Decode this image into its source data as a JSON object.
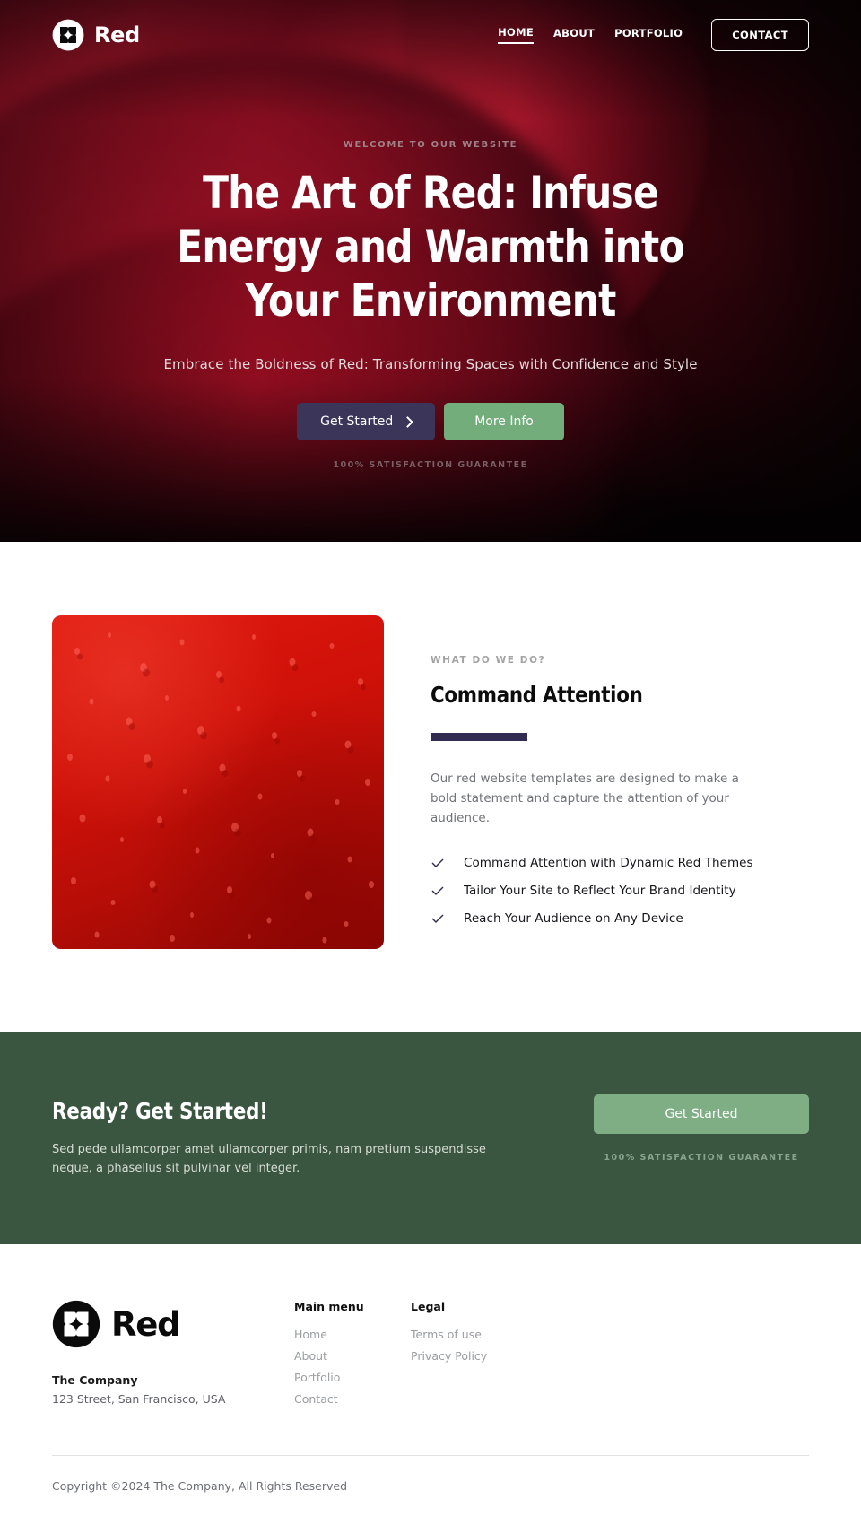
{
  "brand": {
    "name": "Red",
    "logo_icon": "red-petal-logo-icon"
  },
  "nav": {
    "links": [
      {
        "label": "HOME",
        "active": true
      },
      {
        "label": "ABOUT",
        "active": false
      },
      {
        "label": "PORTFOLIO",
        "active": false
      }
    ],
    "cta_label": "CONTACT"
  },
  "hero": {
    "eyebrow": "WELCOME TO OUR WEBSITE",
    "title": "The Art of Red: Infuse Energy and Warmth into Your Environment",
    "subtitle": "Embrace the Boldness of Red: Transforming Spaces with Confidence and Style",
    "primary_button": "Get Started",
    "primary_button_icon": "chevron-right-icon",
    "secondary_button": "More Info",
    "guarantee": "100% SATISFACTION GUARANTEE",
    "colors": {
      "background": "#060204",
      "accent_red": "#c3152d",
      "primary_button": "#3a3559",
      "secondary_button": "#74ad7c"
    }
  },
  "feature": {
    "eyebrow": "WHAT DO WE DO?",
    "title": "Command Attention",
    "body": "Our red website templates are designed to make a bold statement and capture the attention of your audience.",
    "image_alt": "red-water-droplets-image",
    "rule_color": "#322c52",
    "items": [
      {
        "icon": "check-icon",
        "label": "Command Attention with Dynamic Red Themes"
      },
      {
        "icon": "check-icon",
        "label": "Tailor Your Site to Reflect Your Brand Identity"
      },
      {
        "icon": "check-icon",
        "label": "Reach Your Audience on Any Device"
      }
    ]
  },
  "cta": {
    "title": "Ready? Get Started!",
    "body": "Sed pede ullamcorper amet ullamcorper primis, nam pretium suspendisse neque, a phasellus sit pulvinar vel integer.",
    "button_label": "Get Started",
    "guarantee": "100% SATISFACTION GUARANTEE",
    "colors": {
      "background": "#3a5540",
      "button": "#7fae85"
    }
  },
  "footer": {
    "brand_name": "Red",
    "company": "The Company",
    "address": "123 Street, San Francisco, USA",
    "columns": [
      {
        "title": "Main menu",
        "links": [
          "Home",
          "About",
          "Portfolio",
          "Contact"
        ]
      },
      {
        "title": "Legal",
        "links": [
          "Terms of use",
          "Privacy Policy"
        ]
      }
    ],
    "copyright": "Copyright ©2024 The Company, All Rights Reserved"
  }
}
